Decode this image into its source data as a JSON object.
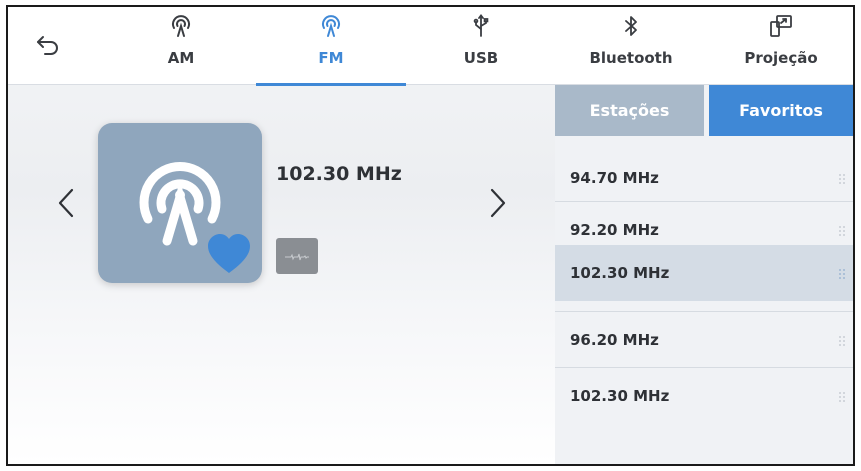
{
  "header": {
    "back_icon": "back-arrow-icon",
    "tabs": [
      {
        "label": "AM",
        "icon": "broadcast-icon",
        "active": false
      },
      {
        "label": "FM",
        "icon": "broadcast-icon",
        "active": true
      },
      {
        "label": "USB",
        "icon": "usb-icon",
        "active": false
      },
      {
        "label": "Bluetooth",
        "icon": "bluetooth-icon",
        "active": false
      },
      {
        "label": "Projeção",
        "icon": "projection-icon",
        "active": false
      }
    ]
  },
  "player": {
    "frequency": "102.30 MHz",
    "favorite": true,
    "art_icon": "radio-tower-icon"
  },
  "panel": {
    "segments": [
      {
        "label": "Estações",
        "active": false
      },
      {
        "label": "Favoritos",
        "active": true
      }
    ],
    "favorites": [
      {
        "label": "94.70 MHz",
        "selected": false
      },
      {
        "label": "92.20 MHz",
        "selected": false
      },
      {
        "label": "102.30 MHz",
        "selected": true
      },
      {
        "label": "96.20 MHz",
        "selected": false
      },
      {
        "label": "102.30 MHz",
        "selected": false
      }
    ]
  },
  "colors": {
    "accent": "#3f88d6",
    "art_background": "#8fa6bd",
    "selected_row": "#d4dce5",
    "segment_inactive": "#a9b9c9"
  }
}
